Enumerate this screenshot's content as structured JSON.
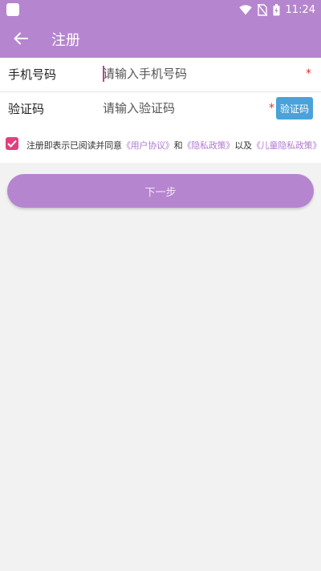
{
  "status_bar": {
    "time": "11:24"
  },
  "app_bar": {
    "title": "注册"
  },
  "form": {
    "phone": {
      "label": "手机号码",
      "placeholder": "请输入手机号码",
      "required_mark": "*"
    },
    "code": {
      "label": "验证码",
      "placeholder": "请输入验证码",
      "required_mark": "*",
      "button_label": "验证码"
    }
  },
  "agreement": {
    "checked": true,
    "prefix": "注册即表示已阅读并同意",
    "link_user_agreement": "《用户协议》",
    "and": "和",
    "link_privacy": "《隐私政策》",
    "as_well_as": "以及",
    "link_child_privacy": "《儿童隐私政策》"
  },
  "next_button": {
    "label": "下一步"
  },
  "colors": {
    "primary": "#b685cf",
    "link": "#b07ad0",
    "checkbox": "#e0407d",
    "code_button": "#4aa2d9",
    "required": "#e23232"
  }
}
